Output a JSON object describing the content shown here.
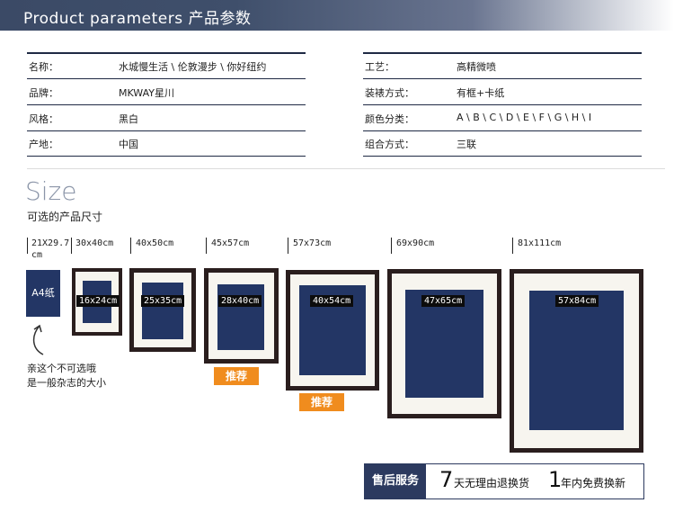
{
  "banner": {
    "title": "Product parameters 产品参数"
  },
  "params_left": [
    {
      "label": "名称：",
      "value": "水城慢生活 \\ 伦敦漫步 \\ 你好纽约"
    },
    {
      "label": "品牌：",
      "value": "MKWAY星川"
    },
    {
      "label": "风格：",
      "value": "黑白"
    },
    {
      "label": "产地：",
      "value": "中国"
    }
  ],
  "params_right": [
    {
      "label": "工艺：",
      "value": "高精微喷"
    },
    {
      "label": "装裱方式：",
      "value": "有框+卡纸"
    },
    {
      "label": "颜色分类：",
      "value": "A \\ B \\ C \\ D \\ E \\ F \\ G \\ H \\ I"
    },
    {
      "label": "组合方式：",
      "value": "三联"
    }
  ],
  "size": {
    "title": "Size",
    "subtitle": "可选的产品尺寸",
    "a4_label": "A4纸",
    "note_line1": "亲这个不可选哦",
    "note_line2": "是一般杂志的大小",
    "dimensions": [
      "21X29.7",
      "cm",
      "30x40cm",
      "40x50cm",
      "45x57cm",
      "57x73cm",
      "69x90cm",
      "81x111cm"
    ],
    "inner_sizes": [
      "16x24cm",
      "25x35cm",
      "28x40cm",
      "40x54cm",
      "47x65cm",
      "57x84cm"
    ],
    "recommend_label": "推荐"
  },
  "service": {
    "head": "售后服务",
    "num1": "7",
    "text1": "天无理由退换货",
    "num2": "1",
    "text2": "年内免费换新"
  },
  "colors": {
    "navy": "#233665",
    "frame": "#2a1e1e",
    "mat": "#f7f5ef",
    "accent": "#f08c1e"
  }
}
